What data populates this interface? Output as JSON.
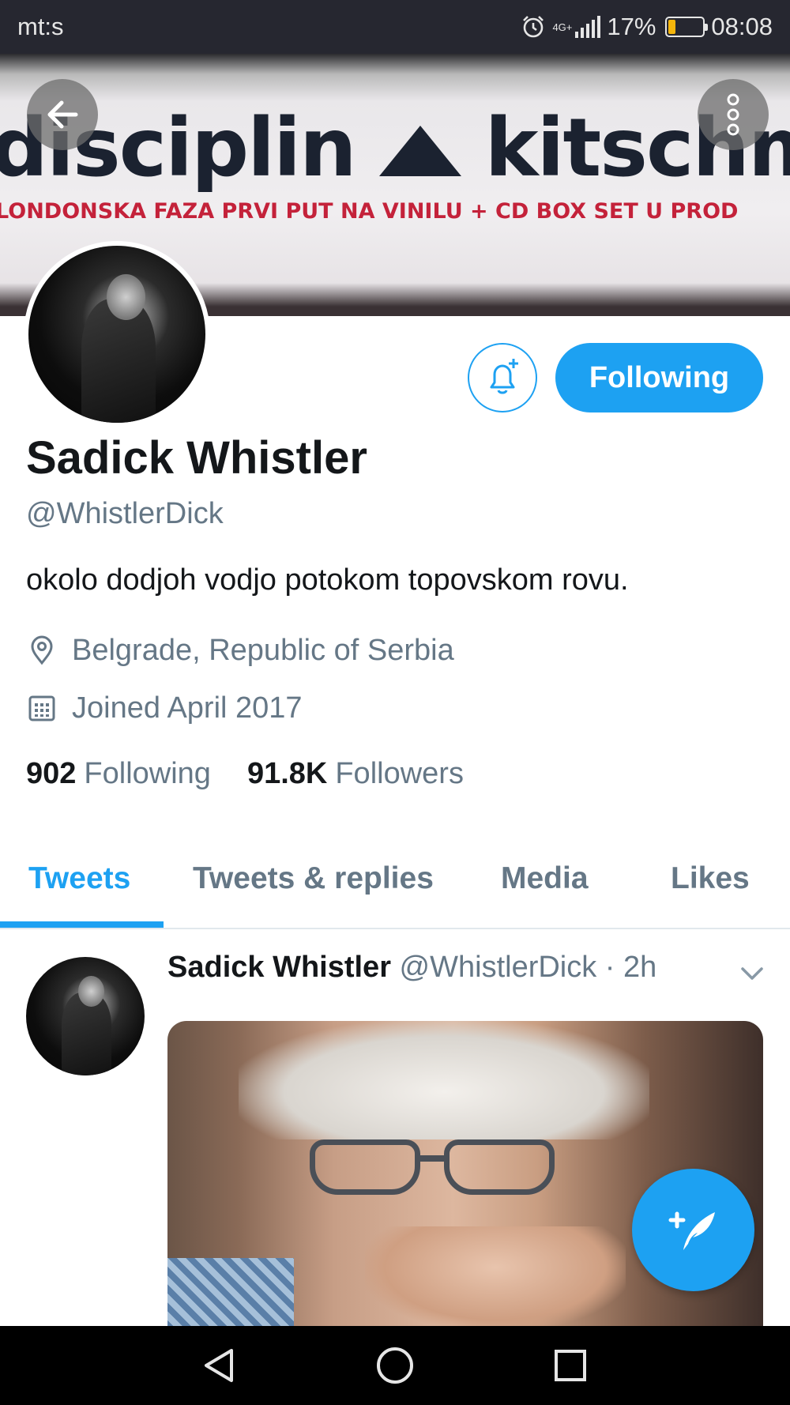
{
  "status_bar": {
    "carrier": "mt:s",
    "network": "4G+",
    "battery_percent": "17%",
    "time": "08:08",
    "icons": [
      "alarm-icon",
      "signal-icon",
      "battery-icon"
    ]
  },
  "banner": {
    "headline_left": "disciplin",
    "headline_right": "kitschm",
    "subline": "LONDONSKA FAZA PRVI PUT NA VINILU + CD BOX SET U PROD"
  },
  "profile": {
    "name": "Sadick Whistler",
    "handle": "@WhistlerDick",
    "bio": "okolo dodjoh vodjo potokom topovskom rovu.",
    "location": "Belgrade, Republic of Serbia",
    "joined": "Joined April 2017",
    "following_count": "902",
    "following_label": "Following",
    "followers_count": "91.8K",
    "followers_label": "Followers",
    "follow_button": "Following"
  },
  "tabs": [
    {
      "label": "Tweets",
      "active": true
    },
    {
      "label": "Tweets & replies",
      "active": false
    },
    {
      "label": "Media",
      "active": false
    },
    {
      "label": "Likes",
      "active": false
    }
  ],
  "tweet": {
    "author": "Sadick Whistler",
    "handle_time": "@WhistlerDick · 2h"
  },
  "colors": {
    "accent": "#1da1f2",
    "text_primary": "#14171a",
    "text_secondary": "#657786",
    "status_bar_bg": "#262730"
  }
}
